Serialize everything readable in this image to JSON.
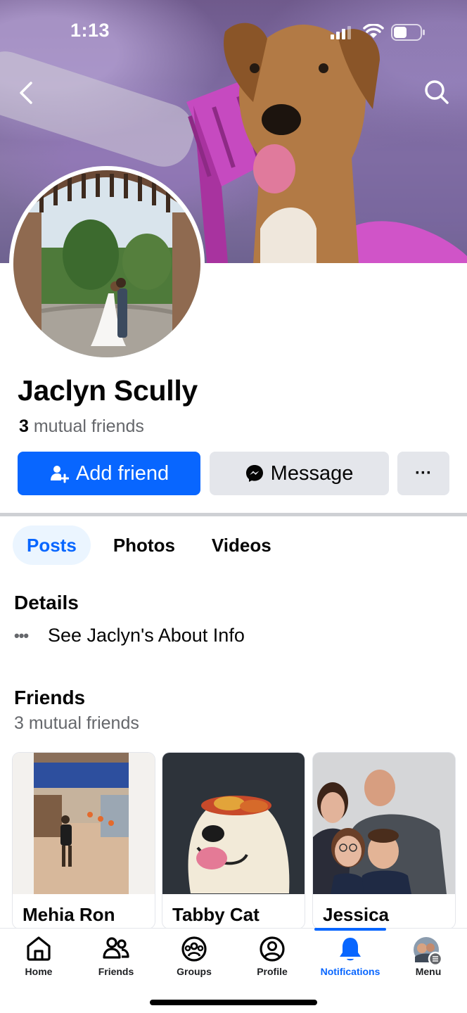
{
  "status_bar": {
    "time": "1:13"
  },
  "header": {
    "back_icon": "chevron-left-icon",
    "search_icon": "search-icon"
  },
  "profile": {
    "name": "Jaclyn Scully",
    "mutual_count": "3",
    "mutual_label": "mutual friends"
  },
  "actions": {
    "add_friend": "Add friend",
    "message": "Message",
    "more": "···"
  },
  "tabs": [
    {
      "label": "Posts",
      "active": true
    },
    {
      "label": "Photos",
      "active": false
    },
    {
      "label": "Videos",
      "active": false
    }
  ],
  "details": {
    "heading": "Details",
    "about_link": "See Jaclyn's About Info"
  },
  "friends": {
    "heading": "Friends",
    "subtitle": "3 mutual friends",
    "cards": [
      {
        "name": "Mehia Ron"
      },
      {
        "name": "Tabby Cat"
      },
      {
        "name": "Jessica"
      }
    ]
  },
  "bottom_nav": [
    {
      "label": "Home",
      "icon": "home-icon"
    },
    {
      "label": "Friends",
      "icon": "friends-icon"
    },
    {
      "label": "Groups",
      "icon": "groups-icon"
    },
    {
      "label": "Profile",
      "icon": "profile-icon"
    },
    {
      "label": "Notifications",
      "icon": "bell-icon",
      "active": true
    },
    {
      "label": "Menu",
      "icon": "menu-avatar-icon"
    }
  ],
  "colors": {
    "primary": "#0866ff",
    "secondary_bg": "#e4e6eb",
    "muted_text": "#65676b"
  }
}
